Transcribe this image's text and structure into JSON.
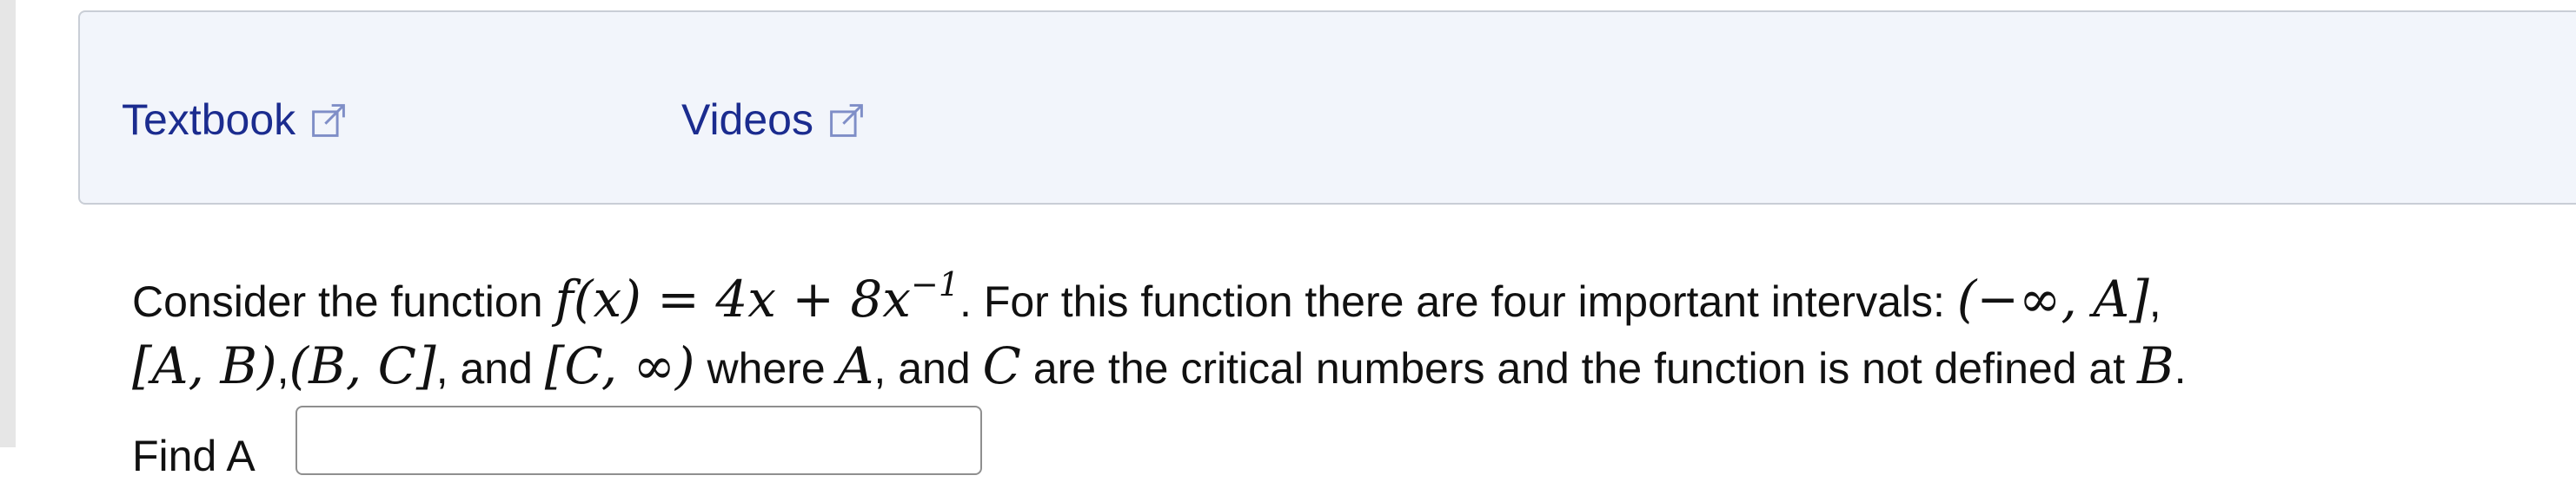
{
  "resources": {
    "textbook_label": "Textbook",
    "videos_label": "Videos",
    "external_icon": "external-link-icon",
    "link_color": "#1b2c8f"
  },
  "question": {
    "lead": "Consider the function ",
    "func_lhs": "f(x)",
    "func_eq": " = 4x + 8x",
    "exponent": "−1",
    "after_func": ". For this function there are four important intervals: ",
    "interval_1": "(−∞, A]",
    "after_interval_1": ",",
    "interval_2": "[A, B)",
    "sep_1": ",",
    "interval_3": "(B, C]",
    "and_text": ", and ",
    "interval_4": "[C, ∞)",
    "where_text": " where ",
    "var_a": "A",
    "mid_text": ", and ",
    "var_c": "C",
    "tail_text": " are the critical numbers and the function is not defined at ",
    "var_b": "B",
    "period": "."
  },
  "answer": {
    "find_label": "Find A",
    "value": "",
    "placeholder": ""
  }
}
